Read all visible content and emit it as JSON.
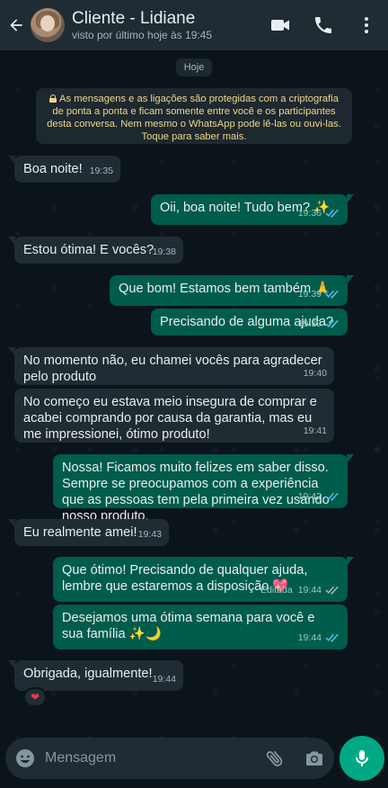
{
  "header": {
    "contact_name": "Cliente - Lidiane",
    "last_seen": "visto por último hoje às 19:45"
  },
  "date_chip": "Hoje",
  "encryption_notice": "As mensagens e as ligações são protegidas com a criptografia de ponta a ponta e ficam somente entre você e os participantes desta conversa. Nem mesmo o WhatsApp pode lê-las ou ouvi-las. Toque para saber mais.",
  "messages": [
    {
      "dir": "in",
      "text": "Boa noite!",
      "time": "19:35"
    },
    {
      "dir": "out",
      "text": "Oii, boa noite! Tudo bem? ✨",
      "time": "19:36"
    },
    {
      "dir": "in",
      "text": "Estou ótima! E vocês?",
      "time": "19:38"
    },
    {
      "dir": "out",
      "text": "Que bom! Estamos bem também 🙏",
      "time": "19:39"
    },
    {
      "dir": "out",
      "text": "Precisando de alguma ajuda?",
      "time": "19:39"
    },
    {
      "dir": "in",
      "text": "No momento não, eu chamei vocês para agradecer pelo produto",
      "time": "19:40"
    },
    {
      "dir": "in",
      "text": "No começo eu estava meio insegura de comprar e acabei comprando por causa da garantia, mas eu me impressionei, ótimo produto!",
      "time": "19:41"
    },
    {
      "dir": "out",
      "text": "Nossa! Ficamos muito felizes em saber disso. Sempre se preocupamos com a experiência que as pessoas tem pela primeira vez usando nosso produto.",
      "time": "19:42"
    },
    {
      "dir": "in",
      "text": "Eu realmente amei!",
      "time": "19:43"
    },
    {
      "dir": "out",
      "text": "Que ótimo! Precisando de qualquer ajuda, lembre que estaremos a disposição 💖",
      "time": "19:44",
      "edited": "Editada"
    },
    {
      "dir": "out",
      "text": "Desejamos uma ótima semana para você e sua família ✨🌙",
      "time": "19:44"
    },
    {
      "dir": "in",
      "text": "Obrigada, igualmente!",
      "time": "19:44"
    }
  ],
  "reaction": "❤",
  "input": {
    "placeholder": "Mensagem"
  },
  "colors": {
    "incoming_bubble": "#202c33",
    "outgoing_bubble": "#005c4b",
    "accent": "#00a884",
    "read_ticks": "#53bdeb"
  },
  "icons": [
    "back-arrow-icon",
    "video-call-icon",
    "phone-icon",
    "more-vert-icon",
    "lock-icon",
    "double-check-icon",
    "emoji-icon",
    "attach-icon",
    "camera-icon",
    "mic-icon"
  ]
}
